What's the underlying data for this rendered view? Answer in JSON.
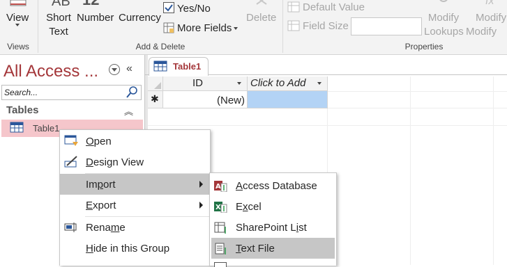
{
  "ribbon": {
    "view_label": "View",
    "short_text_label": "Short Text",
    "number_label": "Number",
    "currency_label": "Currency",
    "yes_no_label": "Yes/No",
    "more_fields_label": "More Fields",
    "delete_label": "Delete",
    "default_value_label": "Default Value",
    "field_size_label": "Field Size",
    "modify_lookups_label": "Modify Lookups",
    "modify_expression_label": "Modify Expressio",
    "groups": {
      "views": "Views",
      "add_delete": "Add & Delete",
      "properties": "Properties"
    }
  },
  "nav": {
    "title": "All Access ...",
    "search_placeholder": "Search...",
    "section_label": "Tables",
    "items": [
      {
        "label": "Table1"
      }
    ]
  },
  "document": {
    "tab_label": "Table1",
    "columns": [
      "ID",
      "Click to Add"
    ],
    "new_row_marker": "✱",
    "new_row_value": "(New)"
  },
  "context_menu": {
    "items": [
      {
        "label": "Open",
        "mnemonic": "O",
        "rest": "pen"
      },
      {
        "label": "Design View",
        "mnemonic": "D",
        "rest": "esign View"
      },
      {
        "label": "Import",
        "pre": "Im",
        "mnemonic": "p",
        "rest": "ort"
      },
      {
        "label": "Export",
        "pre": "",
        "mnemonic": "E",
        "rest": "xport"
      },
      {
        "label": "Rename",
        "pre": "Rena",
        "mnemonic": "m",
        "rest": "e"
      },
      {
        "label": "Hide in this Group",
        "mnemonic": "H",
        "rest": "ide in this Group"
      }
    ]
  },
  "submenu": {
    "items": [
      {
        "label": "Access Database",
        "mnemonic": "A",
        "rest": "ccess Database"
      },
      {
        "label": "Excel",
        "pre": "E",
        "mnemonic": "x",
        "rest": "cel"
      },
      {
        "label": "SharePoint List",
        "pre": "SharePoint L",
        "mnemonic": "i",
        "rest": "st"
      },
      {
        "label": "Text File",
        "mnemonic": "T",
        "rest": "ext File"
      }
    ]
  },
  "colors": {
    "accent": "#a4373a",
    "selection": "#f5c6cb",
    "menu_highlight": "#c6c6c6",
    "cell_selected": "#b3d3f5"
  }
}
